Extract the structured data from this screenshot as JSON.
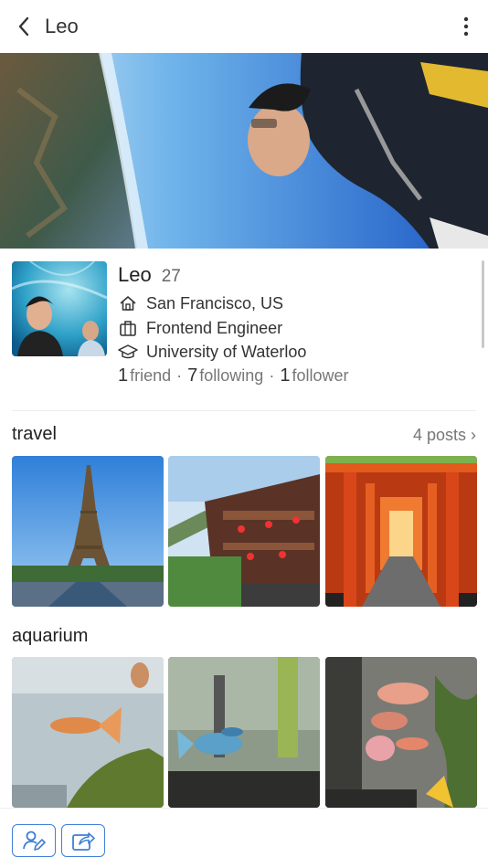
{
  "header": {
    "title": "Leo",
    "back_icon": "chevron-left-icon",
    "menu_icon": "more-vertical-icon"
  },
  "profile": {
    "name": "Leo",
    "age": "27",
    "location": "San Francisco, US",
    "job": "Frontend Engineer",
    "school": "University of Waterloo",
    "stats": {
      "friends_count": "1",
      "friends_label": "friend",
      "following_count": "7",
      "following_label": "following",
      "followers_count": "1",
      "followers_label": "follower",
      "separator": "·"
    }
  },
  "albums": [
    {
      "title": "travel",
      "posts_label": "4 posts ›"
    },
    {
      "title": "aquarium"
    }
  ],
  "bottom_bar": {
    "edit_profile_icon": "user-edit-icon",
    "share_icon": "share-icon",
    "accent_color": "#3f7fd6"
  }
}
